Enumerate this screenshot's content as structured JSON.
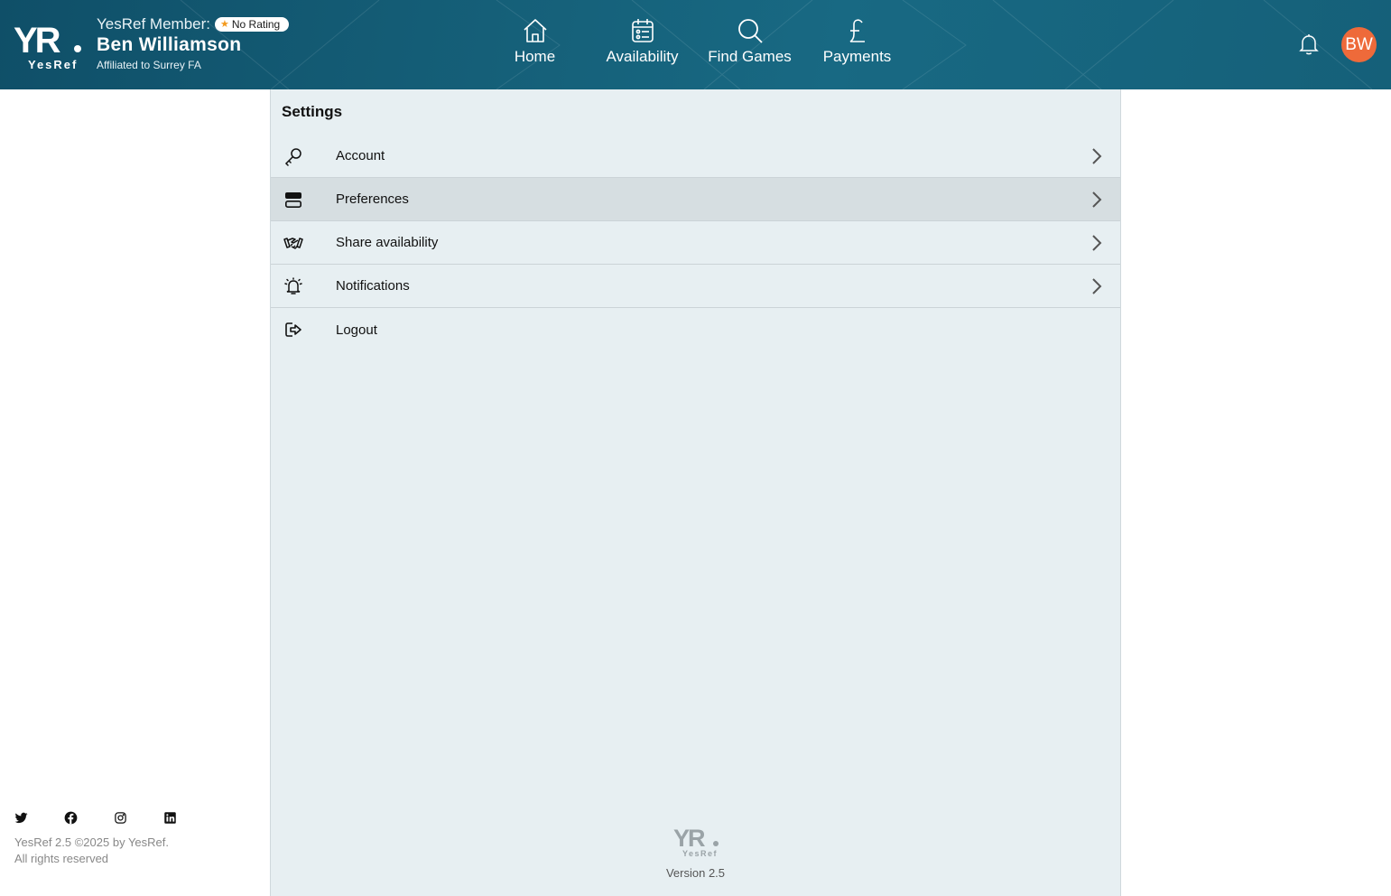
{
  "header": {
    "logo_text": "YR.",
    "logo_sub": "YesRef",
    "member_label": "YesRef Member:",
    "rating_badge": "No Rating",
    "user_name": "Ben Williamson",
    "affiliation": "Affiliated to Surrey FA",
    "avatar_initials": "BW",
    "nav": [
      {
        "label": "Home",
        "icon": "home-icon"
      },
      {
        "label": "Availability",
        "icon": "calendar-icon"
      },
      {
        "label": "Find Games",
        "icon": "search-icon"
      },
      {
        "label": "Payments",
        "icon": "pound-icon"
      }
    ]
  },
  "settings": {
    "title": "Settings",
    "items": [
      {
        "label": "Account",
        "icon": "key-icon",
        "has_chevron": true,
        "active": false
      },
      {
        "label": "Preferences",
        "icon": "toggle-icon",
        "has_chevron": true,
        "active": true
      },
      {
        "label": "Share availability",
        "icon": "handshake-icon",
        "has_chevron": true,
        "active": false
      },
      {
        "label": "Notifications",
        "icon": "alarm-bell-icon",
        "has_chevron": true,
        "active": false
      },
      {
        "label": "Logout",
        "icon": "logout-icon",
        "has_chevron": false,
        "active": false
      }
    ],
    "version": "Version 2.5"
  },
  "footer": {
    "social": [
      "twitter-icon",
      "facebook-icon",
      "instagram-icon",
      "linkedin-icon"
    ],
    "copyright_line1": "YesRef 2.5 ©2025 by YesRef.",
    "copyright_line2": "All rights reserved"
  },
  "colors": {
    "header_bg": "#155f78",
    "avatar_bg": "#ee6a3a",
    "panel_bg": "#e7eff2",
    "active_row_bg": "#d6dee1",
    "rating_star": "#f39a1e"
  }
}
